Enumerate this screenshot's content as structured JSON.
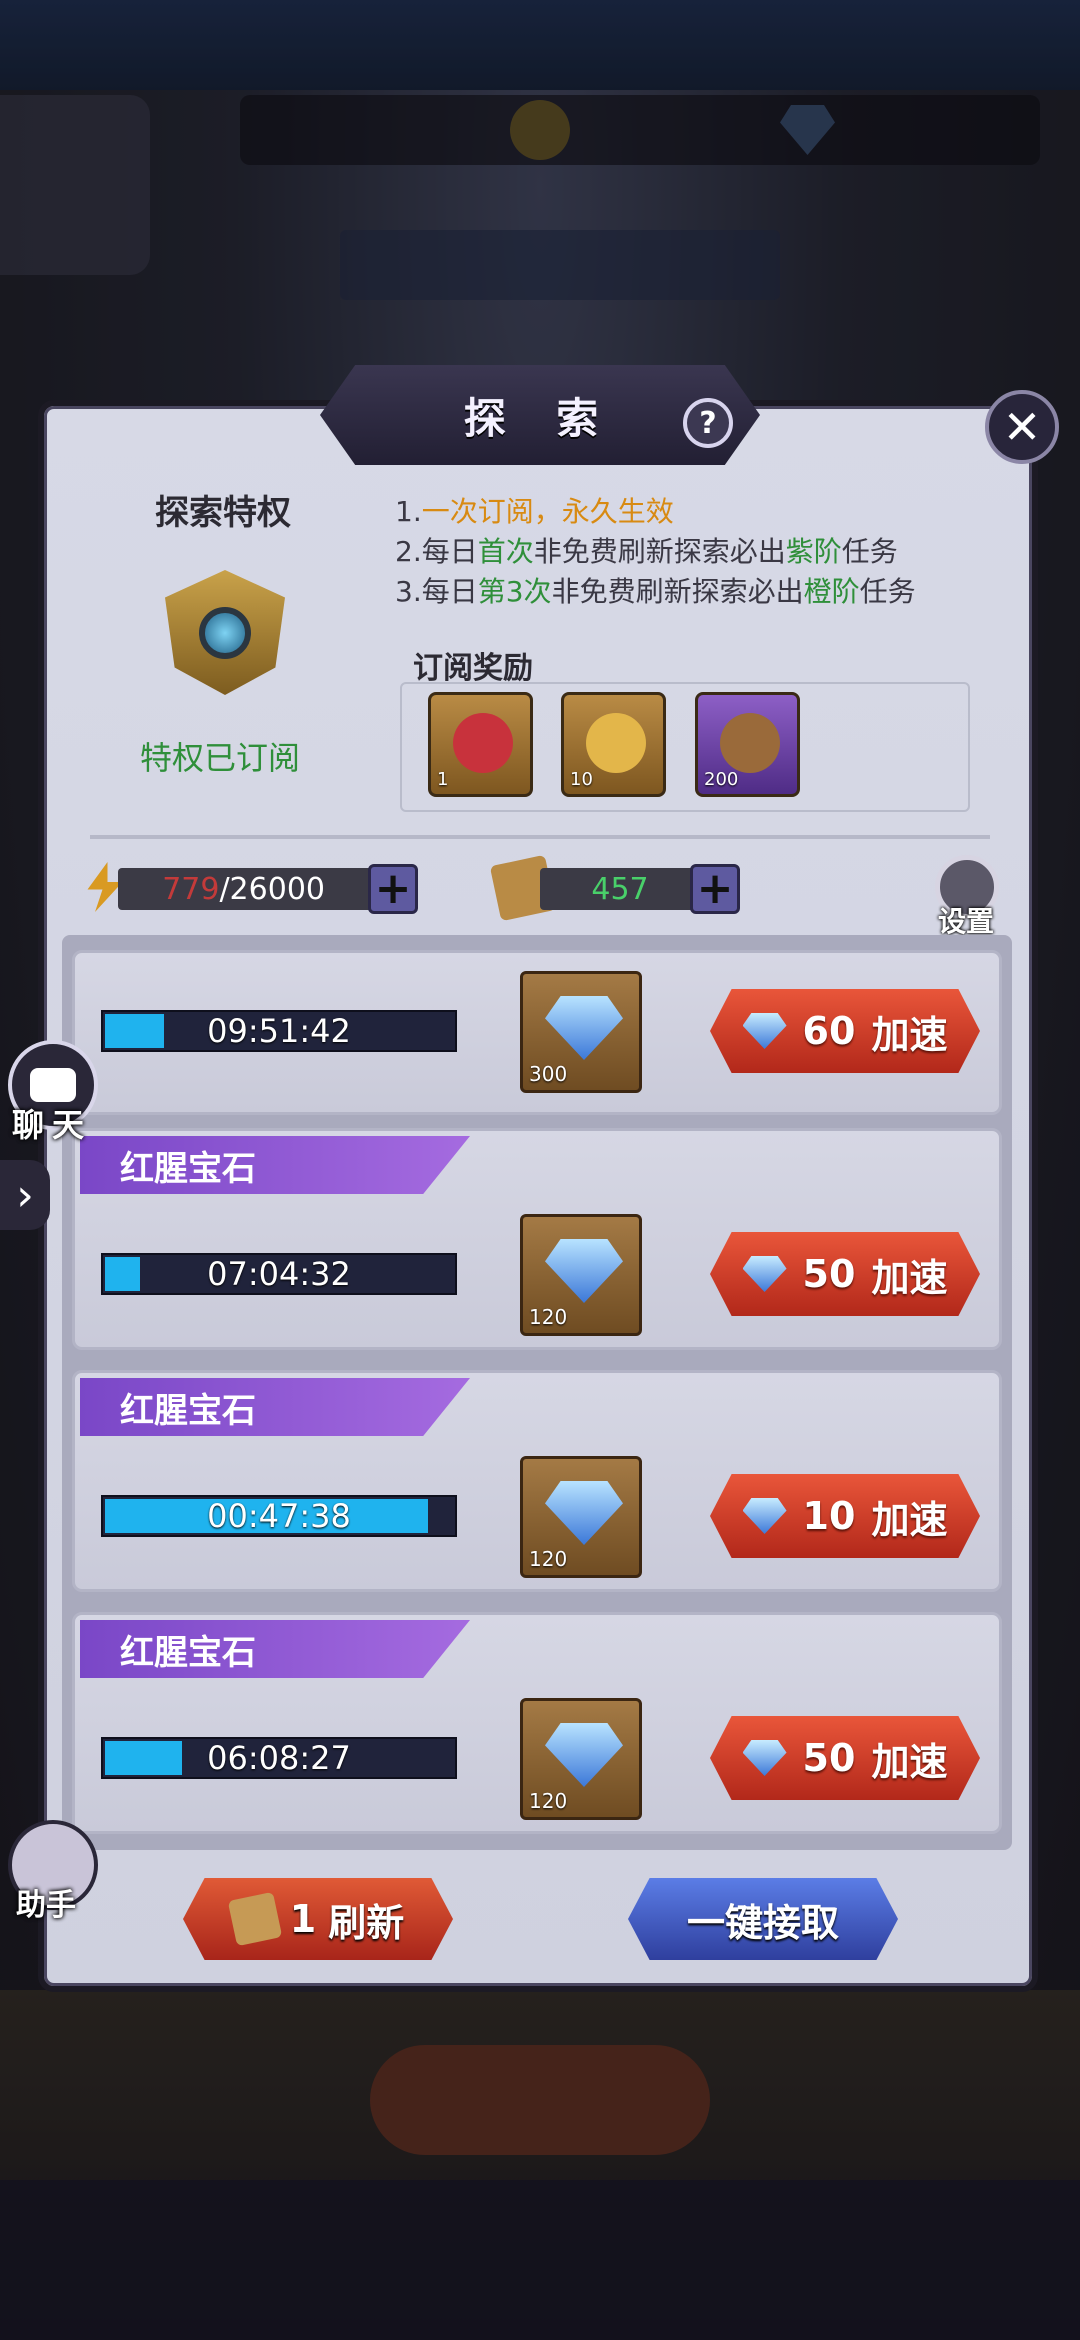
{
  "panel": {
    "title": "探 索",
    "help_icon": "?",
    "close_icon": "✕"
  },
  "privilege": {
    "title": "探索特权",
    "status": "特权已订阅",
    "rules": [
      {
        "n": "1.",
        "parts": [
          {
            "t": "一次订阅，永久生效",
            "c": "orange"
          }
        ]
      },
      {
        "n": "2.",
        "parts": [
          {
            "t": "每日",
            "c": ""
          },
          {
            "t": "首次",
            "c": "green"
          },
          {
            "t": "非免费刷新探索必出",
            "c": ""
          },
          {
            "t": "紫阶",
            "c": "green"
          },
          {
            "t": "任务",
            "c": ""
          }
        ]
      },
      {
        "n": "3.",
        "parts": [
          {
            "t": "每日",
            "c": ""
          },
          {
            "t": "第3次",
            "c": "green"
          },
          {
            "t": "非免费刷新探索必出",
            "c": ""
          },
          {
            "t": "橙阶",
            "c": "green"
          },
          {
            "t": "任务",
            "c": ""
          }
        ]
      }
    ],
    "reward_label": "订阅奖励",
    "rewards": [
      {
        "icon": "heart-gem-icon",
        "count": "1",
        "style": "gold"
      },
      {
        "icon": "scroll-icon",
        "count": "10",
        "style": "gold"
      },
      {
        "icon": "ore-icon",
        "count": "200",
        "style": "purple"
      }
    ]
  },
  "resources": {
    "energy_current": "779",
    "energy_max": "/26000",
    "scrolls": "457",
    "plus": "+",
    "settings_label": "设置"
  },
  "tasks": [
    {
      "name": "",
      "timer": "09:51:42",
      "progress": 0.18,
      "reward_count": "300",
      "speed_cost": "60",
      "speed_label": "加速"
    },
    {
      "name": "红腥宝石",
      "timer": "07:04:32",
      "progress": 0.11,
      "reward_count": "120",
      "speed_cost": "50",
      "speed_label": "加速"
    },
    {
      "name": "红腥宝石",
      "timer": "00:47:38",
      "progress": 0.93,
      "reward_count": "120",
      "speed_cost": "10",
      "speed_label": "加速"
    },
    {
      "name": "红腥宝石",
      "timer": "06:08:27",
      "progress": 0.23,
      "reward_count": "120",
      "speed_cost": "50",
      "speed_label": "加速"
    }
  ],
  "side": {
    "chat_label": "聊天",
    "arrow": "›",
    "helper_label": "助手"
  },
  "buttons": {
    "refresh_count": "1",
    "refresh_label": "刷新",
    "claim_all": "一键接取"
  },
  "colors": {
    "accent_red": "#d9402a",
    "accent_blue": "#3f56c0",
    "progress_blue": "#1fb3ee",
    "task_purple": "#8a55d6"
  }
}
